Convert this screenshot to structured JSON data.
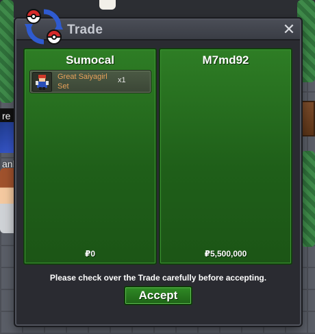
{
  "window": {
    "title": "Trade",
    "close_symbol": "✕",
    "emblem_icon": "pokeball-swap-icon"
  },
  "trade": {
    "left_panel": {
      "player_name": "Sumocal",
      "items": [
        {
          "name": "Great Saiyagirl Set",
          "quantity": "x1",
          "icon": "costume-icon"
        }
      ],
      "money": "₽0"
    },
    "right_panel": {
      "player_name": "M7md92",
      "items": [],
      "money": "₽5,500,000"
    },
    "notice": "Please check over the Trade carefully before accepting.",
    "accept_label": "Accept"
  },
  "background": {
    "label_1": "re",
    "label_2": "anb"
  },
  "colors": {
    "panel_green": "#2e7d25",
    "item_name_orange": "#e8a25a",
    "window_bg": "#2a2b31"
  }
}
